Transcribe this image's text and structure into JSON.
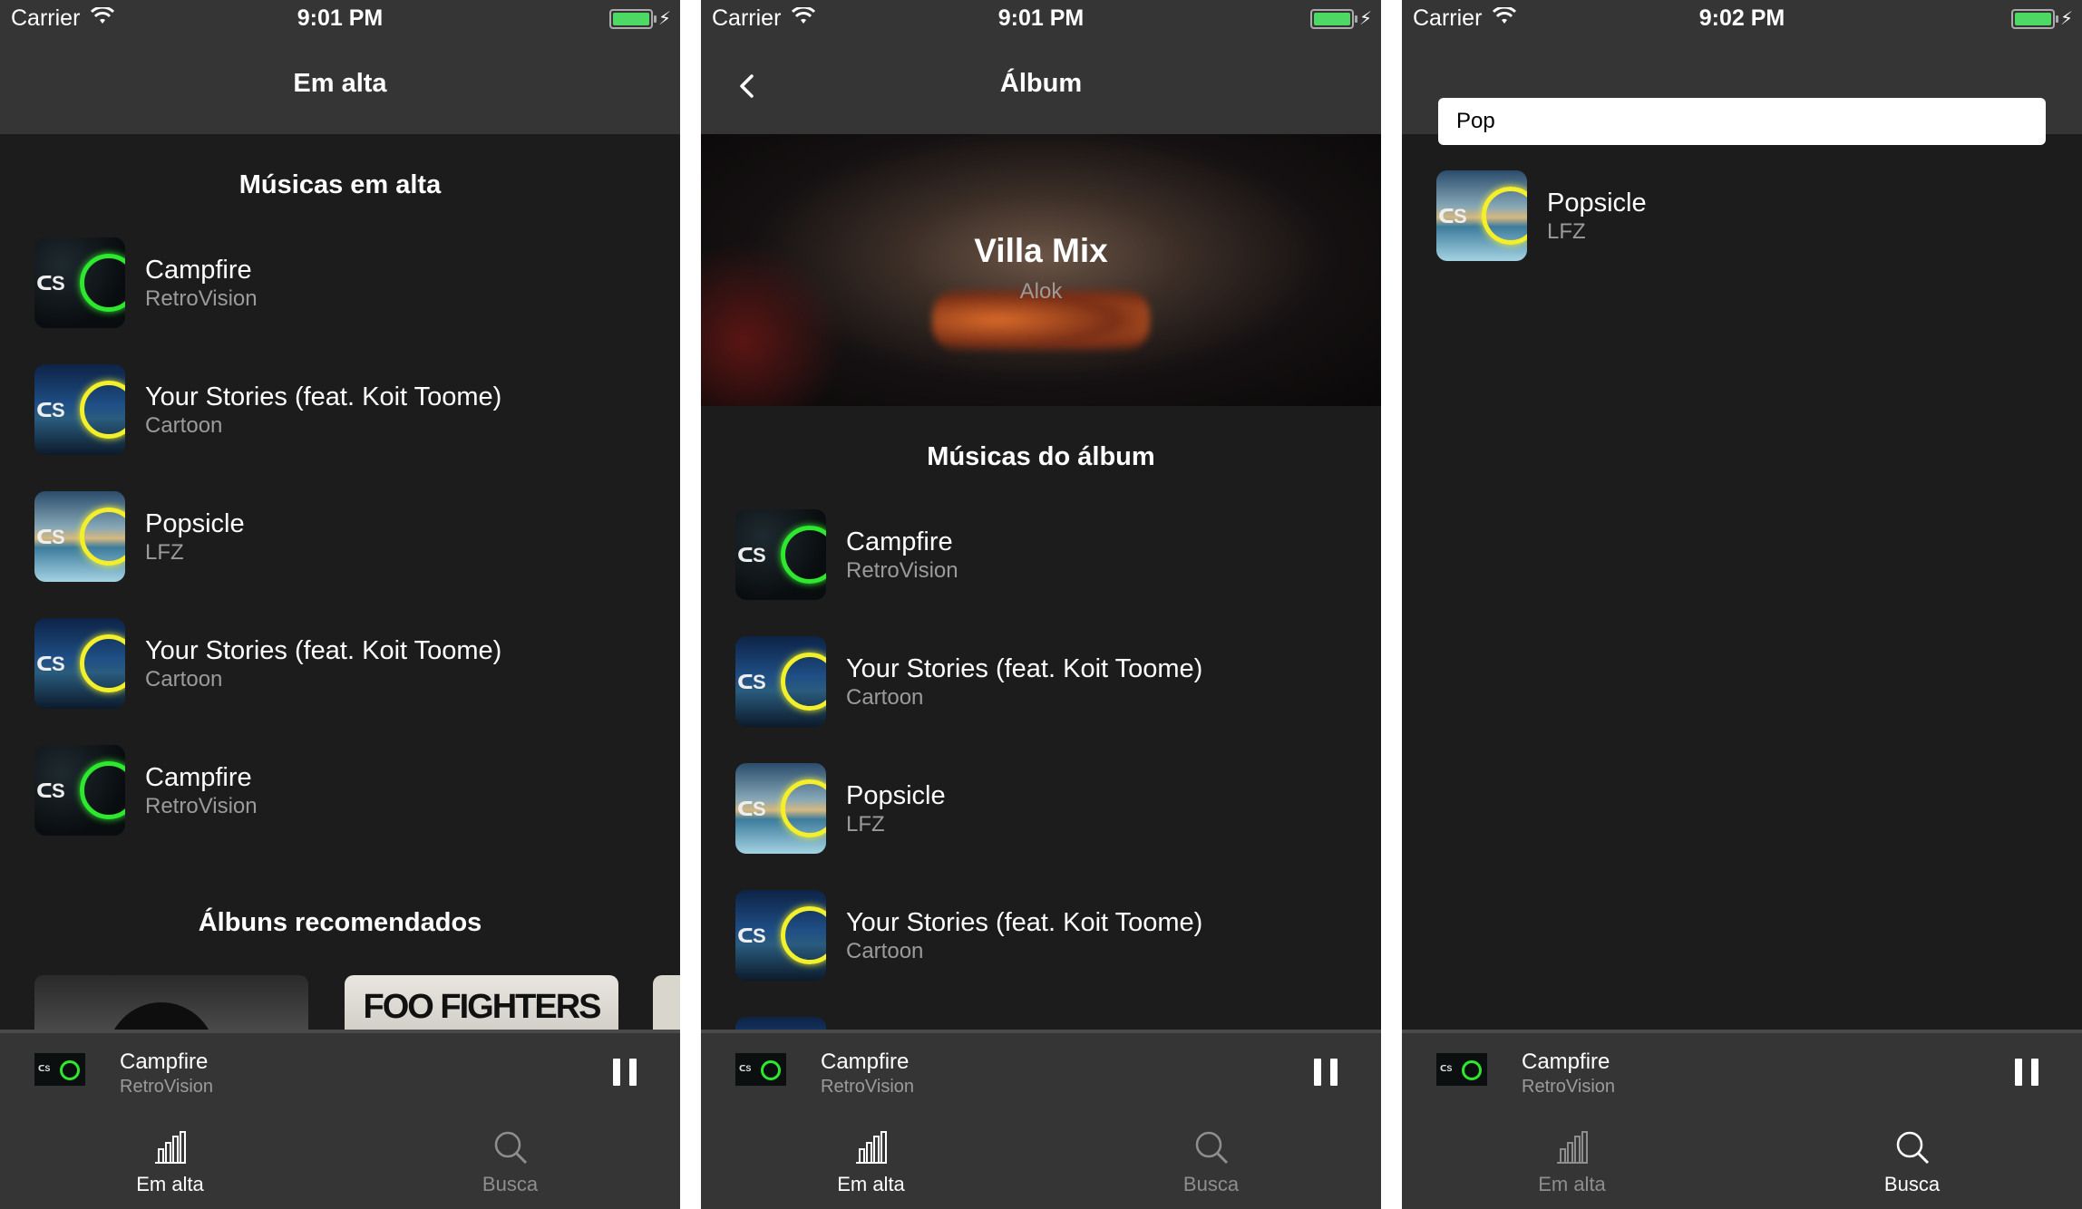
{
  "status_bar": {
    "carrier": "Carrier",
    "time_1": "9:01 PM",
    "time_2": "9:01 PM",
    "time_3": "9:02 PM"
  },
  "colors": {
    "nav_bg": "#353535",
    "content_bg": "#1c1c1d",
    "battery": "#4cd964",
    "text_secondary": "#9b9b9b"
  },
  "trending": {
    "title": "Em alta",
    "songs_heading": "Músicas em alta",
    "songs": [
      {
        "title": "Campfire",
        "artist": "RetroVision",
        "cover": "campfire"
      },
      {
        "title": "Your Stories (feat. Koit Toome)",
        "artist": "Cartoon",
        "cover": "stories"
      },
      {
        "title": "Popsicle",
        "artist": "LFZ",
        "cover": "popsicle"
      },
      {
        "title": "Your Stories (feat. Koit Toome)",
        "artist": "Cartoon",
        "cover": "stories"
      },
      {
        "title": "Campfire",
        "artist": "RetroVision",
        "cover": "campfire"
      }
    ],
    "albums_heading": "Álbuns recomendados",
    "albums": [
      {
        "cover_text": ""
      },
      {
        "cover_text": "FOO FIGHTERS"
      },
      {
        "cover_text": ""
      }
    ]
  },
  "album": {
    "title": "Álbum",
    "name": "Villa Mix",
    "artist": "Alok",
    "songs_heading": "Músicas do álbum",
    "songs": [
      {
        "title": "Campfire",
        "artist": "RetroVision",
        "cover": "campfire"
      },
      {
        "title": "Your Stories (feat. Koit Toome)",
        "artist": "Cartoon",
        "cover": "stories"
      },
      {
        "title": "Popsicle",
        "artist": "LFZ",
        "cover": "popsicle"
      },
      {
        "title": "Your Stories (feat. Koit Toome)",
        "artist": "Cartoon",
        "cover": "stories"
      }
    ]
  },
  "search": {
    "query": "Pop",
    "results": [
      {
        "title": "Popsicle",
        "artist": "LFZ",
        "cover": "popsicle"
      }
    ]
  },
  "mini_player": {
    "title": "Campfire",
    "artist": "RetroVision",
    "state_icon": "pause-icon"
  },
  "tabs": [
    {
      "label": "Em alta",
      "icon": "bar-chart-icon"
    },
    {
      "label": "Busca",
      "icon": "search-icon"
    }
  ],
  "active_tab": [
    "Em alta",
    "Em alta",
    "Busca"
  ]
}
